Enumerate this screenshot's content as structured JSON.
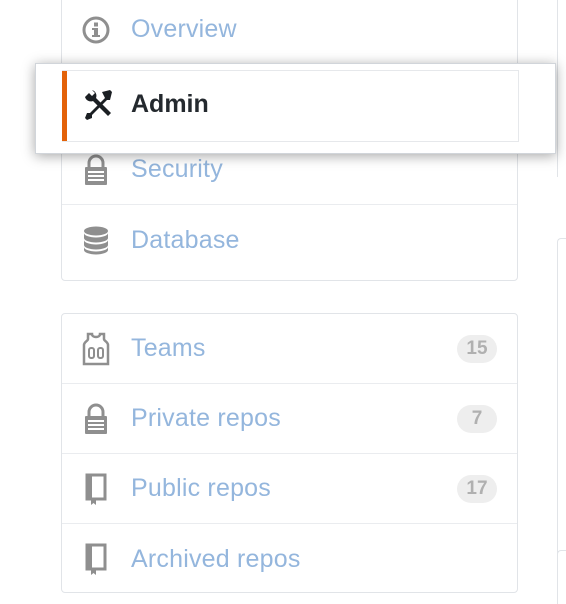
{
  "colors": {
    "accent": "#e36209",
    "link": "#94b6dd",
    "icon": "#8f8f8f",
    "counter_bg": "#eeeeee",
    "counter_text": "#b0b0b0",
    "selected_text": "#24292e"
  },
  "nav_primary": {
    "items": [
      {
        "label": "Overview",
        "icon": "info-icon"
      },
      {
        "label": "Admin",
        "icon": "tools-icon",
        "selected": true
      },
      {
        "label": "Security",
        "icon": "lock-icon"
      },
      {
        "label": "Database",
        "icon": "database-icon"
      }
    ]
  },
  "nav_secondary": {
    "items": [
      {
        "label": "Teams",
        "icon": "jersey-icon",
        "count": "15"
      },
      {
        "label": "Private repos",
        "icon": "lock-icon",
        "count": "7"
      },
      {
        "label": "Public repos",
        "icon": "repo-icon",
        "count": "17"
      },
      {
        "label": "Archived repos",
        "icon": "repo-icon"
      }
    ]
  }
}
